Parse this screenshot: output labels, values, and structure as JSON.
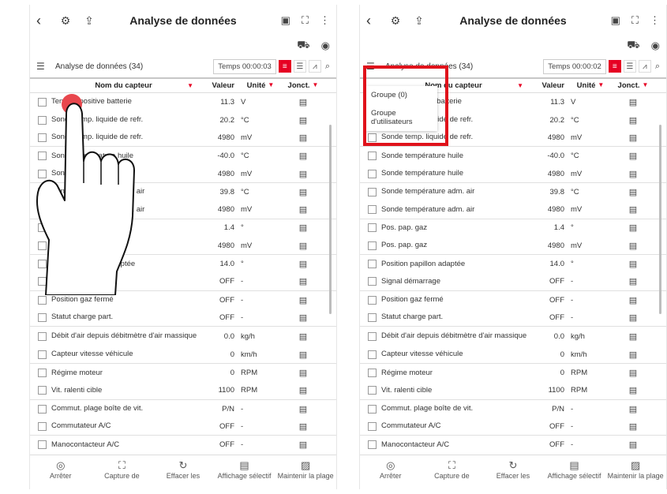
{
  "screens": [
    {
      "title": "Analyse de données",
      "toolbar": {
        "label": "Analyse de données (34)",
        "time": "Temps 00:00:03"
      },
      "headers": {
        "name": "Nom du capteur",
        "value": "Valeur",
        "unit": "Unité",
        "junction": "Jonct."
      },
      "rows": [
        {
          "name": "Tension positive batterie",
          "value": "11.3",
          "unit": "V"
        },
        {
          "name": "Sonde temp. liquide de refr.",
          "value": "20.2",
          "unit": "°C"
        },
        {
          "name": "Sonde temp. liquide de refr.",
          "value": "4980",
          "unit": "mV"
        },
        {
          "name": "Sonde température huile",
          "value": "-40.0",
          "unit": "°C"
        },
        {
          "name": "Sonde température huile",
          "value": "4980",
          "unit": "mV"
        },
        {
          "name": "Sonde température adm. air",
          "value": "39.8",
          "unit": "°C"
        },
        {
          "name": "Sonde température adm. air",
          "value": "4980",
          "unit": "mV"
        },
        {
          "name": "Pos. pap. gaz",
          "value": "1.4",
          "unit": "°"
        },
        {
          "name": "Pos. pap. gaz",
          "value": "4980",
          "unit": "mV"
        },
        {
          "name": "Position papillon adaptée",
          "value": "14.0",
          "unit": "°"
        },
        {
          "name": "Signal démarrage",
          "value": "OFF",
          "unit": "-"
        },
        {
          "name": "Position gaz fermé",
          "value": "OFF",
          "unit": "-"
        },
        {
          "name": "Statut charge part.",
          "value": "OFF",
          "unit": "-"
        },
        {
          "name": "Débit d'air depuis débitmètre d'air massique",
          "value": "0.0",
          "unit": "kg/h"
        },
        {
          "name": "Capteur vitesse véhicule",
          "value": "0",
          "unit": "km/h"
        },
        {
          "name": "Régime moteur",
          "value": "0",
          "unit": "RPM"
        },
        {
          "name": "Vit. ralenti cible",
          "value": "1100",
          "unit": "RPM"
        },
        {
          "name": "Commut. plage boîte de vit.",
          "value": "P/N",
          "unit": "-"
        },
        {
          "name": "Commutateur A/C",
          "value": "OFF",
          "unit": "-"
        },
        {
          "name": "Manocontacteur A/C",
          "value": "OFF",
          "unit": "-"
        }
      ],
      "bottom": [
        "Arrêter",
        "Capture de",
        "Effacer les",
        "Affichage sélectif",
        "Maintenir la plage"
      ]
    },
    {
      "title": "Analyse de données",
      "toolbar": {
        "label": "Analyse de données (34)",
        "time": "Temps 00:00:02"
      },
      "headers": {
        "name": "Nom du capteur",
        "value": "Valeur",
        "unit": "Unité",
        "junction": "Jonct."
      },
      "dropdown": [
        "Groupe (0)",
        "Groupe d'utilisateurs"
      ],
      "rows": [
        {
          "name": "Tension positive batterie",
          "value": "11.3",
          "unit": "V"
        },
        {
          "name": "Sonde temp. liquide de refr.",
          "value": "20.2",
          "unit": "°C"
        },
        {
          "name": "Sonde temp. liquide de refr.",
          "value": "4980",
          "unit": "mV"
        },
        {
          "name": "Sonde température huile",
          "value": "-40.0",
          "unit": "°C"
        },
        {
          "name": "Sonde température huile",
          "value": "4980",
          "unit": "mV"
        },
        {
          "name": "Sonde température adm. air",
          "value": "39.8",
          "unit": "°C"
        },
        {
          "name": "Sonde température adm. air",
          "value": "4980",
          "unit": "mV"
        },
        {
          "name": "Pos. pap. gaz",
          "value": "1.4",
          "unit": "°"
        },
        {
          "name": "Pos. pap. gaz",
          "value": "4980",
          "unit": "mV"
        },
        {
          "name": "Position papillon adaptée",
          "value": "14.0",
          "unit": "°"
        },
        {
          "name": "Signal démarrage",
          "value": "OFF",
          "unit": "-"
        },
        {
          "name": "Position gaz fermé",
          "value": "OFF",
          "unit": "-"
        },
        {
          "name": "Statut charge part.",
          "value": "OFF",
          "unit": "-"
        },
        {
          "name": "Débit d'air depuis débitmètre d'air massique",
          "value": "0.0",
          "unit": "kg/h"
        },
        {
          "name": "Capteur vitesse véhicule",
          "value": "0",
          "unit": "km/h"
        },
        {
          "name": "Régime moteur",
          "value": "0",
          "unit": "RPM"
        },
        {
          "name": "Vit. ralenti cible",
          "value": "1100",
          "unit": "RPM"
        },
        {
          "name": "Commut. plage boîte de vit.",
          "value": "P/N",
          "unit": "-"
        },
        {
          "name": "Commutateur A/C",
          "value": "OFF",
          "unit": "-"
        },
        {
          "name": "Manocontacteur A/C",
          "value": "OFF",
          "unit": "-"
        }
      ],
      "bottom": [
        "Arrêter",
        "Capture de",
        "Effacer les",
        "Affichage sélectif",
        "Maintenir la plage"
      ]
    }
  ],
  "icons": {
    "back": "‹",
    "junction": "▤",
    "more": "⋮",
    "search": "⌕"
  },
  "colors": {
    "accent": "#e60023",
    "highlight": "#e0121b"
  }
}
